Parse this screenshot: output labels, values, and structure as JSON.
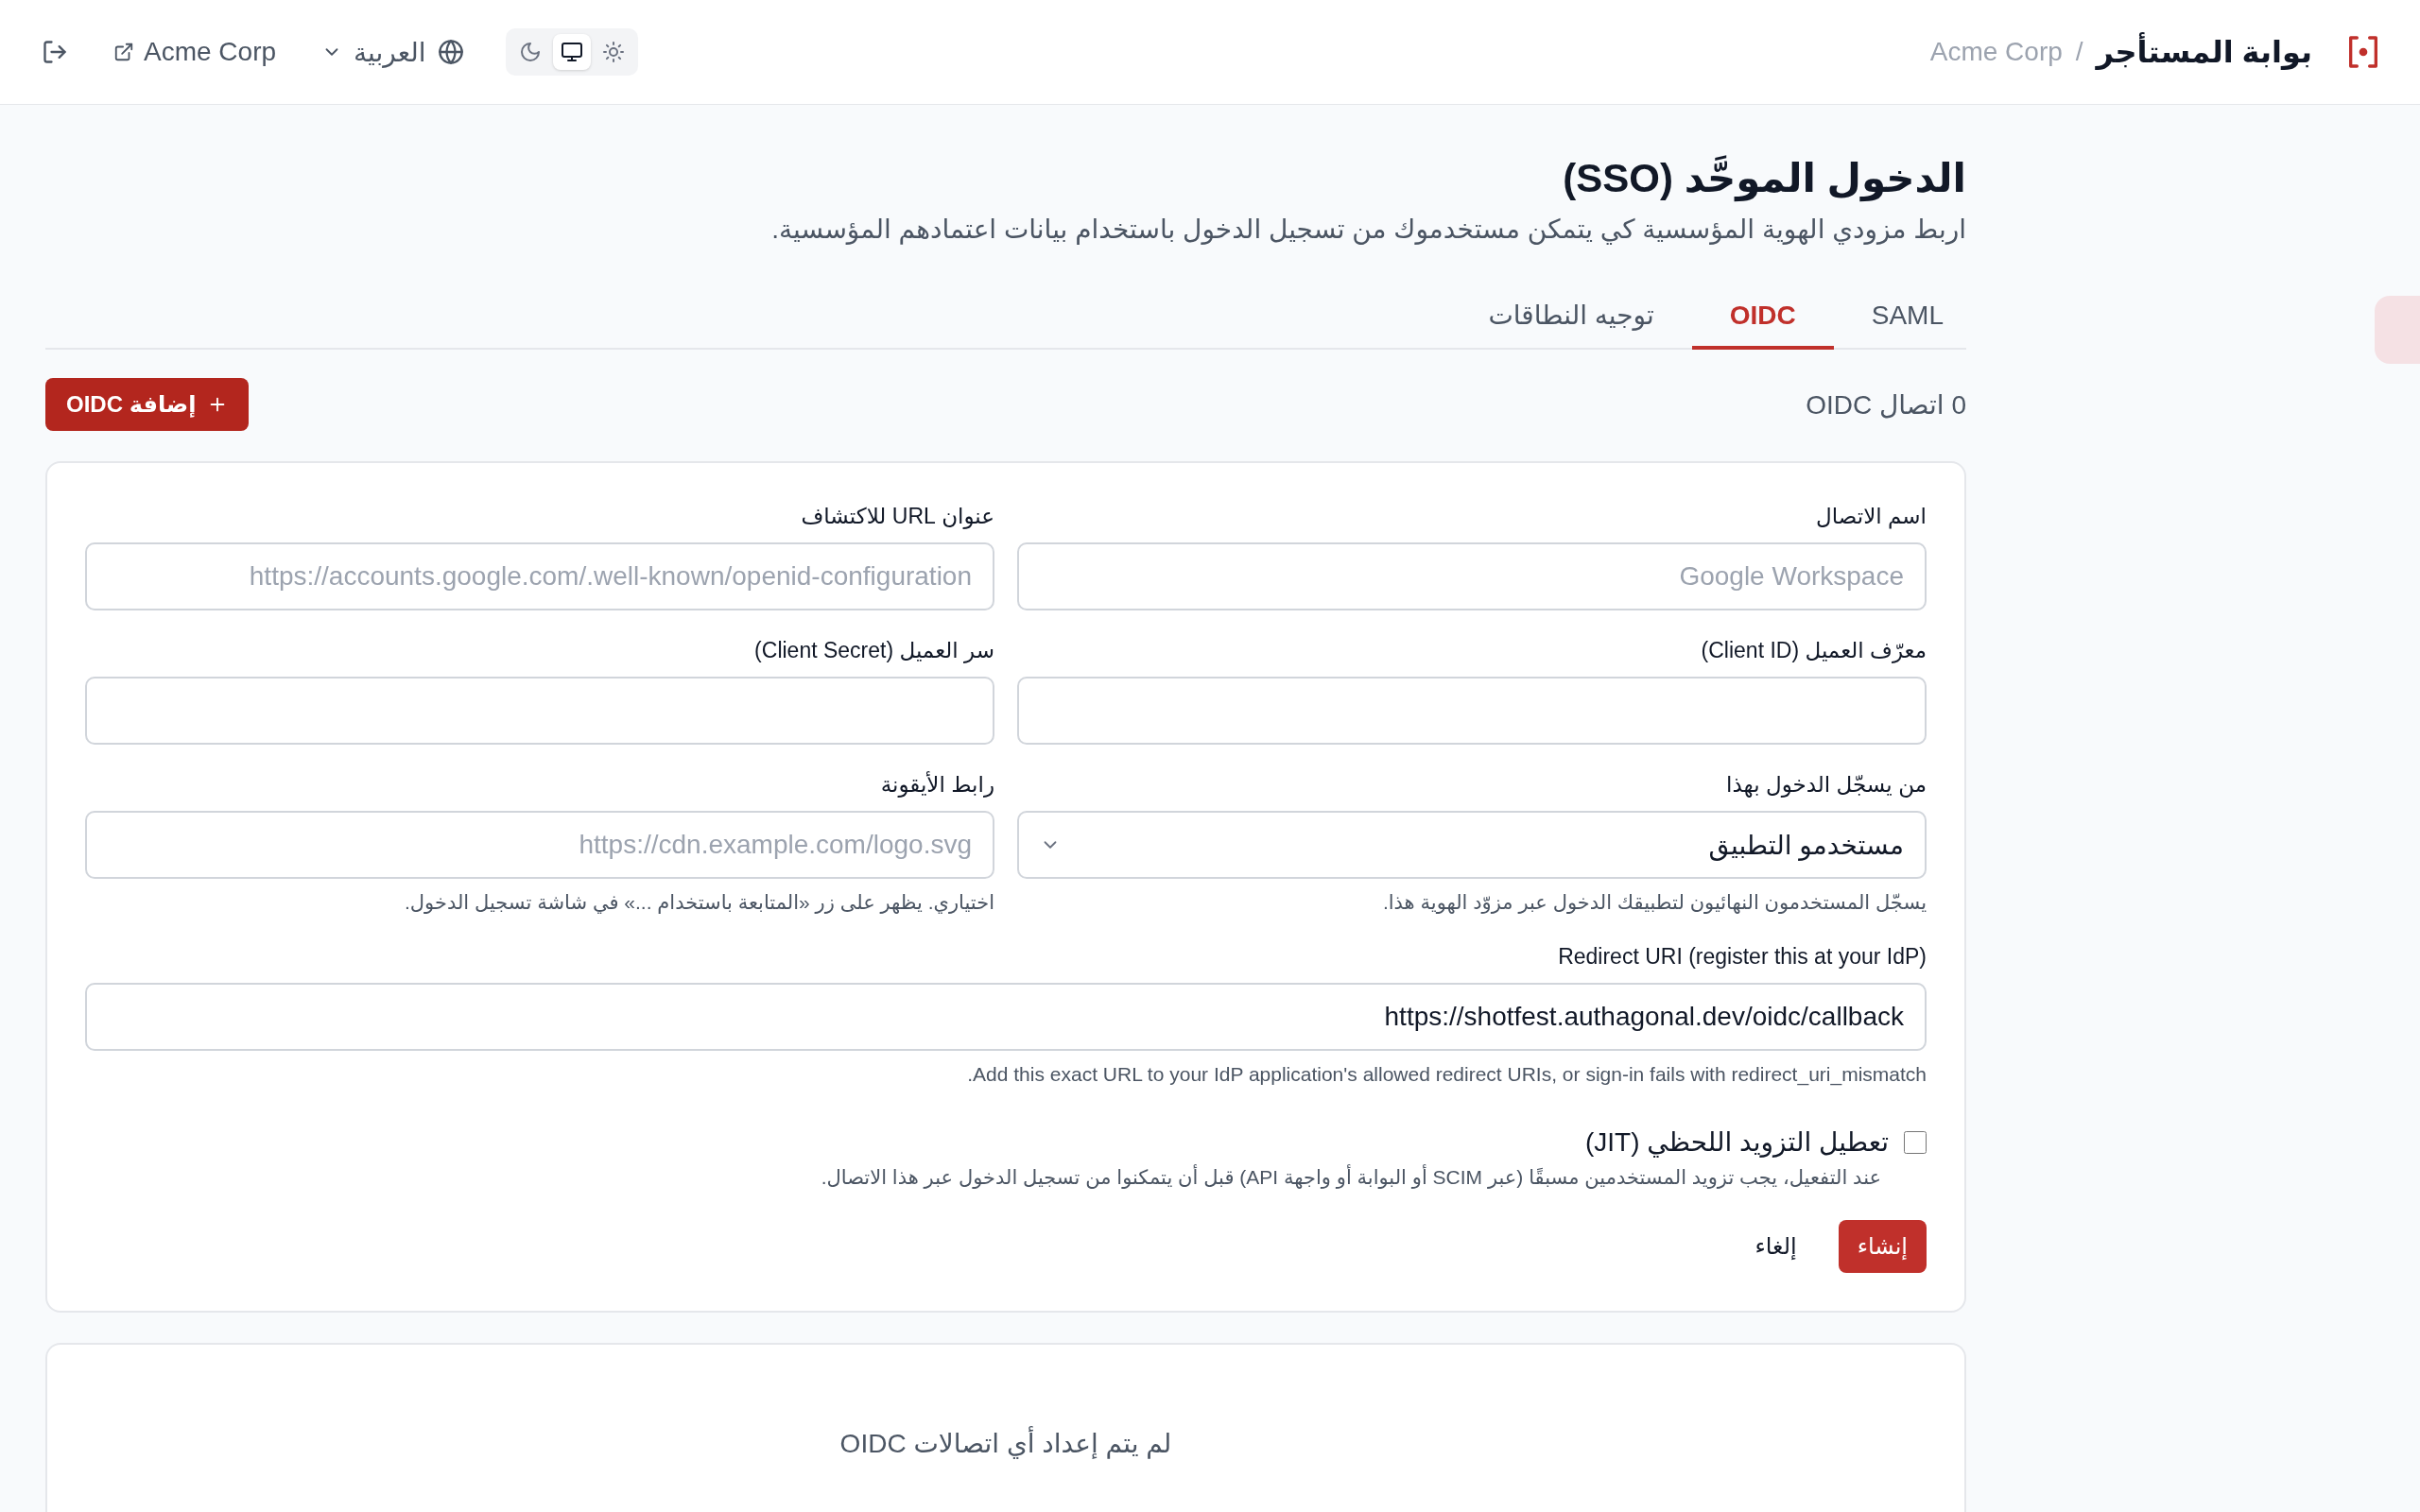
{
  "header": {
    "brand": {
      "title": "بوابة المستأجر",
      "separator": "/",
      "org": "Acme Corp"
    },
    "theme_switcher": [
      {
        "kind": "light",
        "selected": false
      },
      {
        "kind": "system",
        "selected": true
      },
      {
        "kind": "dark",
        "selected": false
      }
    ],
    "language": "العربية",
    "org_link": "Acme Corp"
  },
  "page": {
    "title": "الدخول الموحَّد (SSO)",
    "subtitle": "اربط مزودي الهوية المؤسسية كي يتمكن مستخدموك من تسجيل الدخول باستخدام بيانات اعتمادهم المؤسسية."
  },
  "tabs": [
    {
      "label": "SAML",
      "selected": false
    },
    {
      "label": "OIDC",
      "selected": true
    },
    {
      "label": "توجيه النطاقات",
      "selected": false
    }
  ],
  "toolbar": {
    "count": "0 اتصال OIDC",
    "add_button": "إضافة OIDC"
  },
  "form": {
    "fields": [
      {
        "kind": "text",
        "label": "اسم الاتصال",
        "placeholder": "Google Workspace"
      },
      {
        "kind": "text",
        "label": "عنوان URL للاكتشاف",
        "placeholder": "https://accounts.google.com/.well-known/openid-configuration"
      },
      {
        "kind": "text",
        "label": "معرّف العميل (Client ID)"
      },
      {
        "kind": "text",
        "label": "سر العميل (Client Secret)"
      },
      {
        "kind": "select",
        "label": "من يسجّل الدخول بهذا",
        "value": "مستخدمو التطبيق",
        "hint": "يسجّل المستخدمون النهائيون لتطبيقك الدخول عبر مزوّد الهوية هذا."
      },
      {
        "kind": "text",
        "label": "رابط الأيقونة",
        "placeholder": "https://cdn.example.com/logo.svg",
        "hint": "اختياري. يظهر على زر «المتابعة باستخدام ...» في شاشة تسجيل الدخول."
      },
      {
        "kind": "readonly",
        "label": "Redirect URI (register this at your IdP)",
        "value": "https://shotfest.authagonal.dev/oidc/callback",
        "hint": "Add this exact URL to your IdP application's allowed redirect URIs, or sign-in fails with redirect_uri_mismatch."
      }
    ],
    "checkbox": {
      "label": "تعطيل التزويد اللحظي (JIT)",
      "checked": false,
      "hint": "عند التفعيل، يجب تزويد المستخدمين مسبقًا (عبر SCIM أو البوابة أو واجهة API) قبل أن يتمكنوا من تسجيل الدخول عبر هذا الاتصال."
    },
    "buttons": [
      {
        "kind": "primary",
        "label": "إنشاء"
      },
      {
        "kind": "secondary",
        "label": "إلغاء"
      }
    ]
  },
  "empty_state": {
    "text": "لم يتم إعداد أي اتصالات OIDC"
  }
}
